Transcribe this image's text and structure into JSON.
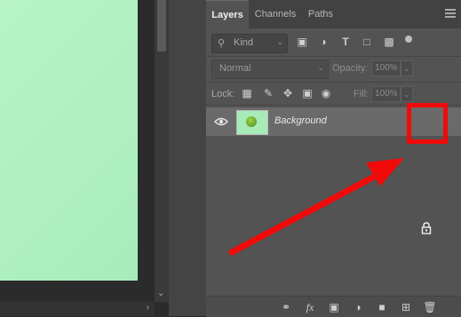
{
  "tabs": [
    {
      "label": "Layers",
      "active": true
    },
    {
      "label": "Channels",
      "active": false
    },
    {
      "label": "Paths",
      "active": false
    }
  ],
  "filter": {
    "kind_label": "Kind"
  },
  "blend": {
    "mode": "Normal",
    "opacity_label": "Opacity:",
    "opacity_value": "100%"
  },
  "lock": {
    "label": "Lock:",
    "fill_label": "Fill:",
    "fill_value": "100%"
  },
  "layers": [
    {
      "name": "Background",
      "locked": true,
      "visible": true
    }
  ],
  "colors": {
    "highlight": "#f00a0a",
    "canvas": "#aef0bf",
    "panel": "#535353"
  },
  "icons": {
    "filter": [
      "image-filter-icon",
      "adjustment-filter-icon",
      "type-filter-icon",
      "shape-filter-icon",
      "smart-object-filter-icon"
    ],
    "lock": [
      "lock-transparent-icon",
      "lock-image-icon",
      "lock-position-icon",
      "lock-artboard-icon",
      "lock-all-icon"
    ],
    "bottom": [
      "link-icon",
      "fx-icon",
      "mask-icon",
      "adjustment-layer-icon",
      "folder-icon",
      "new-layer-icon",
      "trash-icon"
    ]
  }
}
